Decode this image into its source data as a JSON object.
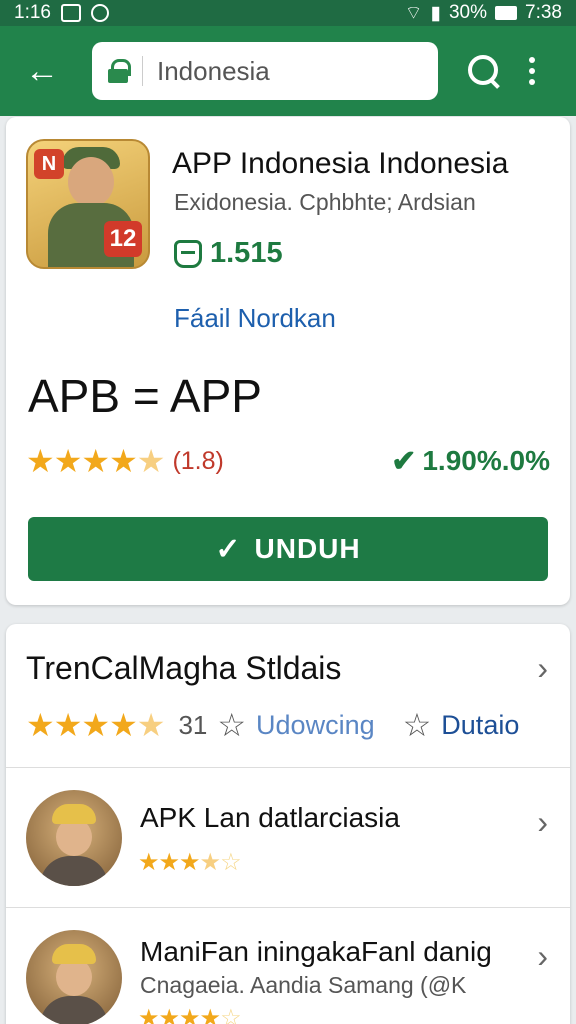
{
  "status_bar": {
    "time_left": "1:16",
    "battery_percent": "30%",
    "time_right": "7:38"
  },
  "toolbar": {
    "url": "Indonesia"
  },
  "app": {
    "title": "APP Indonesia Indonesia",
    "subtitle": "Exidonesia. Cphbhte; Ardsian",
    "size": "1.515",
    "developer": "Fáail Nordkan",
    "big_title": "APB = APP",
    "rating": 4.5,
    "rating_text": "(1.8)",
    "verified_text": "1.90%.0%",
    "install_label": "UNDUH",
    "icon_badge_left": "N",
    "icon_badge_right": "12"
  },
  "section": {
    "title": "TrenCalMagha Stldais",
    "rating": 4.5,
    "count": "31",
    "tab1": "Udowcing",
    "tab2": "Dutaio"
  },
  "items": [
    {
      "title": "APK Lan datlarciasia",
      "subtitle": "",
      "rating": 3.5
    },
    {
      "title": "ManiFan iningakaFanl danig",
      "subtitle": "Cnagaeia. Aandia Samang (@K",
      "rating": 4
    }
  ],
  "colors": {
    "app_bar": "#21834b",
    "accent_green": "#1e7a45",
    "star": "#f2a81b",
    "link_blue": "#1d5fad",
    "rating_red": "#c0392b"
  },
  "icons": [
    "back-arrow-icon",
    "lock-icon",
    "search-icon",
    "more-vert-icon",
    "storage-icon",
    "verified-check-icon",
    "chevron-right-icon",
    "star-outline-icon"
  ]
}
